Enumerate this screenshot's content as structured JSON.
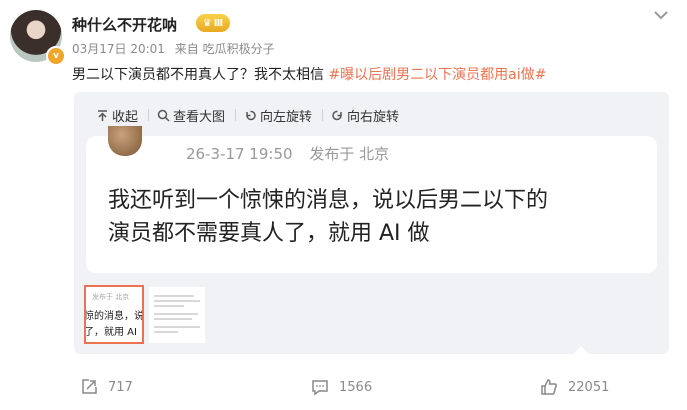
{
  "author": {
    "name": "种什么不开花呐",
    "level_badge": "Ⅲ",
    "date": "03月17日 20:01",
    "source": "来自 吃瓜积极分子"
  },
  "post": {
    "text": "男二以下演员都不用真人了？我不太相信",
    "hashtag": "#曝以后剧男二以下演员都用ai做#"
  },
  "toolbar": {
    "collapse": "收起",
    "view_large": "查看大图",
    "rotate_left": "向左旋转",
    "rotate_right": "向右旋转"
  },
  "screenshot": {
    "datetime": "26-3-17 19:50",
    "location": "发布于 北京",
    "line1": "我还听到一个惊悚的消息，说以后男二以下的",
    "line2": "演员都不需要真人了，就用 AI 做"
  },
  "thumbnail1": {
    "meta": "发布于 北京",
    "line1": "惊的消息，说",
    "line2": "了，就用 AI"
  },
  "footer": {
    "reposts": "717",
    "comments": "1566",
    "likes": "22051"
  },
  "colors": {
    "accent": "#eb7350",
    "hashtag": "#eb7350",
    "panel_bg": "#f1f2f5"
  }
}
